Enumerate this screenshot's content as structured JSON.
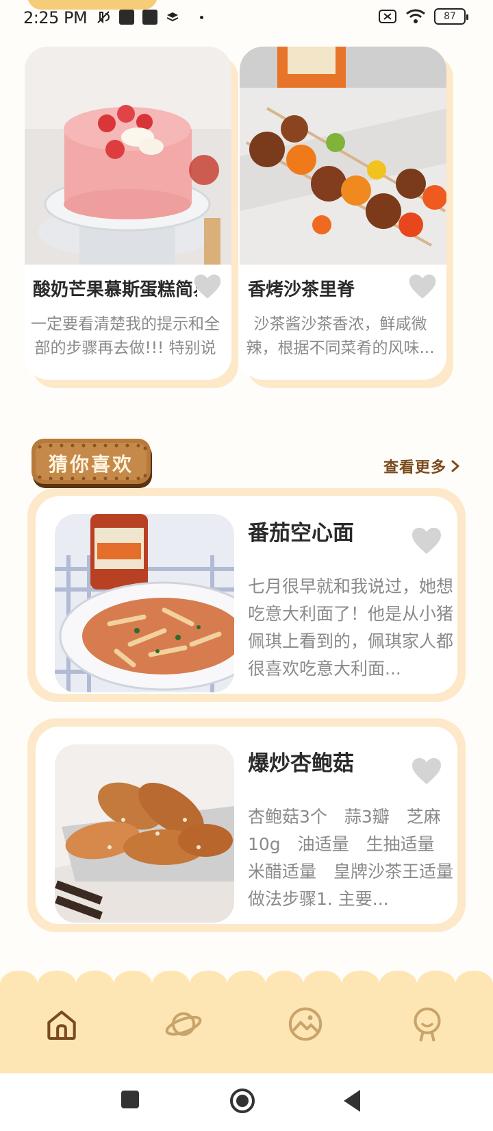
{
  "status_bar": {
    "time": "2:25 PM",
    "battery": "87",
    "icons": [
      "muted-icon",
      "notification-icon",
      "notification-icon",
      "layers-icon",
      "dot-icon",
      "sim-off-icon",
      "wifi-icon",
      "battery-icon"
    ]
  },
  "top_cards": [
    {
      "title": "酸奶芒果慕斯蛋糕简易版",
      "description": "一定要看清楚我的提示和全部的步骤再去做!!! 特别说明...",
      "favorite_icon": "heart-icon"
    },
    {
      "title": "香烤沙茶里脊",
      "description": "沙茶酱沙茶香浓，鲜咸微辣，根据不同菜肴的风味...",
      "favorite_icon": "heart-icon"
    }
  ],
  "section": {
    "title": "猜你喜欢",
    "see_more": "查看更多"
  },
  "list_cards": [
    {
      "title": "番茄空心面",
      "description": "七月很早就和我说过，她想吃意大利面了！他是从小猪佩琪上看到的，佩琪家人都很喜欢吃意大利面...",
      "favorite_icon": "heart-icon"
    },
    {
      "title": "爆炒杏鲍菇",
      "description": "杏鲍菇3个　蒜3瓣　芝麻10g　油适量　生抽适量　米醋适量　皇牌沙茶王适量　做法步骤1. 主要...",
      "favorite_icon": "heart-icon"
    }
  ],
  "tabbar": {
    "tabs": [
      {
        "name": "home",
        "icon": "home-icon"
      },
      {
        "name": "discover",
        "icon": "planet-icon"
      },
      {
        "name": "gallery",
        "icon": "picture-icon"
      },
      {
        "name": "profile",
        "icon": "person-icon"
      }
    ],
    "active_color": "#7a4a1d",
    "inactive_color": "#c9a46a",
    "background": "#fde6b4"
  },
  "system_nav": {
    "buttons": [
      "recents-icon",
      "home-circle-icon",
      "back-icon"
    ]
  }
}
